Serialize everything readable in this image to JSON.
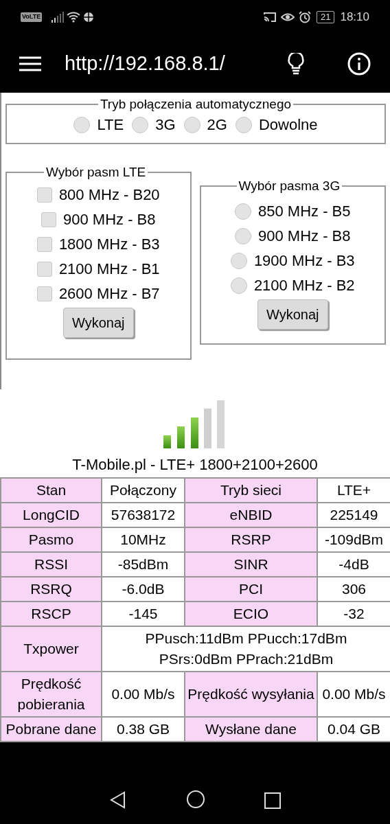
{
  "status_bar": {
    "network_badge": "VoLTE",
    "battery": "21",
    "time": "18:10"
  },
  "app_bar": {
    "title": "http://192.168.8.1/"
  },
  "mode_group": {
    "legend": "Tryb połączenia automatycznego",
    "options": [
      {
        "label": "LTE",
        "selected": false
      },
      {
        "label": "3G",
        "selected": false
      },
      {
        "label": "2G",
        "selected": false
      },
      {
        "label": "Dowolne",
        "selected": false
      }
    ]
  },
  "lte_bands": {
    "legend": "Wybór pasm LTE",
    "items": [
      {
        "label": "800 MHz - B20",
        "checked": false
      },
      {
        "label": "900 MHz - B8",
        "checked": false
      },
      {
        "label": "1800 MHz - B3",
        "checked": false
      },
      {
        "label": "2100 MHz - B1",
        "checked": false
      },
      {
        "label": "2600 MHz - B7",
        "checked": false
      }
    ],
    "button": "Wykonaj"
  },
  "umts_bands": {
    "legend": "Wybór pasma 3G",
    "options": [
      {
        "label": "850 MHz - B5",
        "selected": false
      },
      {
        "label": "900 MHz - B8",
        "selected": false
      },
      {
        "label": "1900 MHz - B3",
        "selected": false
      },
      {
        "label": "2100 MHz - B2",
        "selected": false
      }
    ],
    "button": "Wykonaj"
  },
  "operator": "T-Mobile.pl - LTE+ 1800+2100+2600",
  "table": {
    "rows": [
      [
        {
          "kind": "label",
          "text": "Stan"
        },
        {
          "kind": "value",
          "text": "Połączony"
        },
        {
          "kind": "label",
          "text": "Tryb sieci"
        },
        {
          "kind": "value",
          "text": "LTE+"
        }
      ],
      [
        {
          "kind": "label",
          "text": "LongCID"
        },
        {
          "kind": "value",
          "text": "57638172"
        },
        {
          "kind": "label",
          "text": "eNBID"
        },
        {
          "kind": "value",
          "text": "225149"
        }
      ],
      [
        {
          "kind": "label",
          "text": "Pasmo"
        },
        {
          "kind": "value",
          "text": "10MHz"
        },
        {
          "kind": "label",
          "text": "RSRP"
        },
        {
          "kind": "value",
          "text": "-109dBm"
        }
      ],
      [
        {
          "kind": "label",
          "text": "RSSI"
        },
        {
          "kind": "value",
          "text": "-85dBm"
        },
        {
          "kind": "label",
          "text": "SINR"
        },
        {
          "kind": "value",
          "text": "-4dB"
        }
      ],
      [
        {
          "kind": "label",
          "text": "RSRQ"
        },
        {
          "kind": "value",
          "text": "-6.0dB"
        },
        {
          "kind": "label",
          "text": "PCI"
        },
        {
          "kind": "value",
          "text": "306"
        }
      ],
      [
        {
          "kind": "label",
          "text": "RSCP"
        },
        {
          "kind": "value",
          "text": "-145"
        },
        {
          "kind": "label",
          "text": "ECIO"
        },
        {
          "kind": "value",
          "text": "-32"
        }
      ],
      [
        {
          "kind": "label",
          "text": "Txpower"
        },
        {
          "kind": "wide",
          "colspan": 3,
          "text": "PPusch:11dBm PPucch:17dBm PSrs:0dBm PPrach:21dBm"
        }
      ],
      [
        {
          "kind": "label",
          "text": "Prędkość pobierania"
        },
        {
          "kind": "value",
          "text": "0.00 Mb/s"
        },
        {
          "kind": "label",
          "text": "Prędkość wysyłania"
        },
        {
          "kind": "value",
          "text": "0.00 Mb/s"
        }
      ],
      [
        {
          "kind": "label",
          "text": "Pobrane dane"
        },
        {
          "kind": "value",
          "text": "0.38 GB"
        },
        {
          "kind": "label",
          "text": "Wysłane dane"
        },
        {
          "kind": "value",
          "text": "0.04 GB"
        }
      ]
    ]
  }
}
